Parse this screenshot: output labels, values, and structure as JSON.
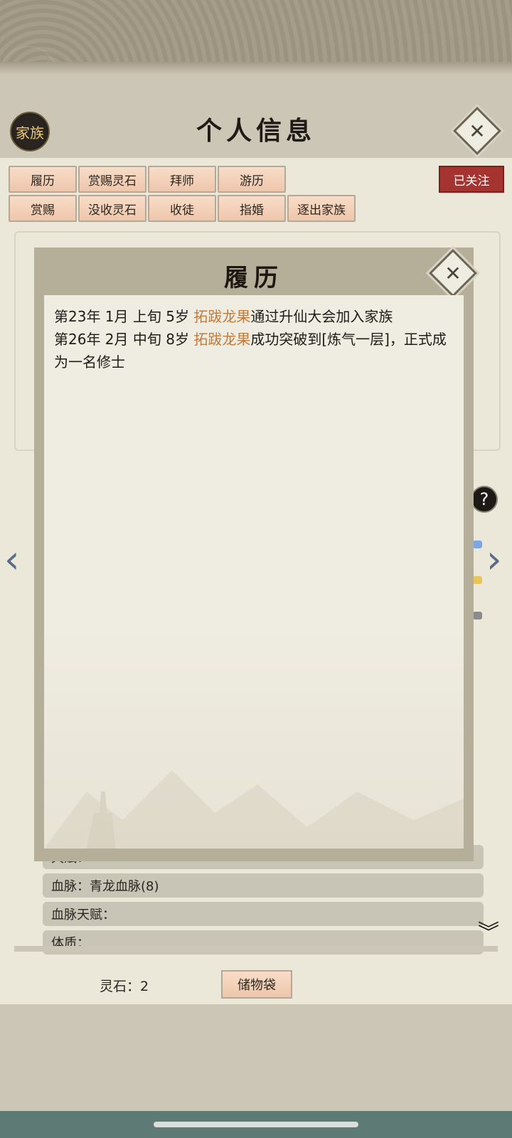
{
  "header": {
    "family_badge": "家族",
    "title": "个人信息"
  },
  "tabs_row1": [
    "履历",
    "赏赐灵石",
    "拜师",
    "游历"
  ],
  "tabs_row2": [
    "赏赐",
    "没收灵石",
    "收徒",
    "指婚",
    "逐出家族"
  ],
  "follow_button": "已关注",
  "background_rows": {
    "talent": "天赋：",
    "bloodline": "血脉：青龙血脉(8)",
    "bloodline_talent": "血脉天赋：",
    "constitution": "体质："
  },
  "footer": {
    "spirit_stones": "灵石：2",
    "storage_button": "储物袋"
  },
  "modal": {
    "title": "履历",
    "entries": [
      {
        "prefix": "第23年 1月 上旬  5岁  ",
        "name": "拓跋龙果",
        "suffix": "通过升仙大会加入家族"
      },
      {
        "prefix": "第26年  2月  中旬   8岁   ",
        "name": "拓跋龙果",
        "suffix": "成功突破到[炼气一层]，正式成为一名修士"
      }
    ]
  },
  "icons": {
    "close": "close-icon",
    "help": "help-icon",
    "prev": "chevron-left-icon",
    "next": "chevron-right-icon",
    "expand": "double-chevron-down-icon"
  },
  "colors": {
    "accent_red": "#a53430",
    "name_highlight": "#c07a3c",
    "button_peach": "#f3d1b9"
  }
}
